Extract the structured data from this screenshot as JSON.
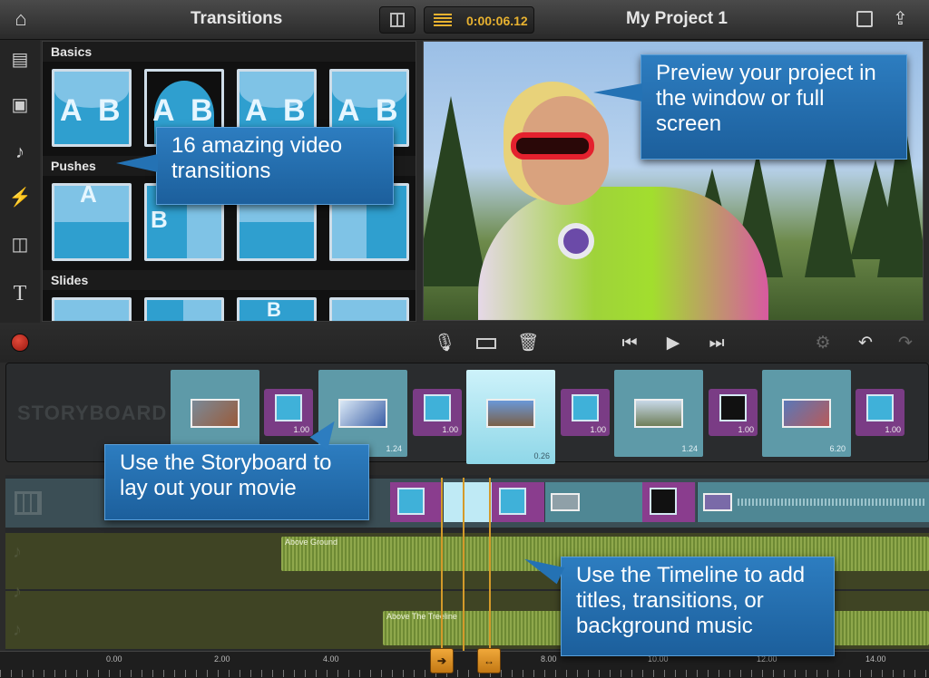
{
  "topbar": {
    "left_title": "Transitions",
    "timecode": "0:00:06.12",
    "project_title": "My Project 1",
    "icons": [
      "home-icon",
      "grid-view-icon",
      "timecode-icon",
      "fullscreen-icon",
      "share-icon"
    ]
  },
  "left_tools": [
    "film-icon",
    "photo-icon",
    "music-note-icon",
    "transition-bolt-icon",
    "overlay-icon",
    "title-text-icon"
  ],
  "transitions_panel": {
    "sections": [
      {
        "title": "Basics"
      },
      {
        "title": "Pushes"
      },
      {
        "title": "Slides"
      }
    ],
    "letters": [
      "A",
      "B"
    ]
  },
  "callouts": {
    "transitions": "16 amazing video transitions",
    "preview": "Preview your project in the window or full screen",
    "storyboard": "Use the Storyboard to lay out your movie",
    "timeline": "Use the Timeline to add titles, transitions, or background music"
  },
  "controls": {
    "icons": [
      "record-icon",
      "microphone-icon",
      "split-clip-icon",
      "trash-icon",
      "skip-back-icon",
      "play-icon",
      "skip-forward-icon",
      "settings-icon",
      "undo-icon",
      "redo-icon"
    ]
  },
  "storyboard": {
    "label": "STORYBOARD",
    "clip_durations": [
      "1.24",
      "0.26",
      "1.24",
      "6.20"
    ],
    "transition_durations": [
      "1.00",
      "1.00",
      "1.00",
      "1.00",
      "1.00"
    ]
  },
  "timeline": {
    "audio_tracks": [
      {
        "label": "Above Ground"
      },
      {
        "label": "Above The Treeline"
      }
    ]
  },
  "ruler": [
    "0.00",
    "2.00",
    "4.00",
    "8.00",
    "10.00",
    "12.00",
    "14.00"
  ],
  "playhead": {
    "left_label": "➔",
    "right_label": "↔"
  },
  "colors": {
    "accent": "#e8b230",
    "callout": "#2d7dc0",
    "transition": "#7a3c85",
    "clip": "#5e9aa8"
  }
}
